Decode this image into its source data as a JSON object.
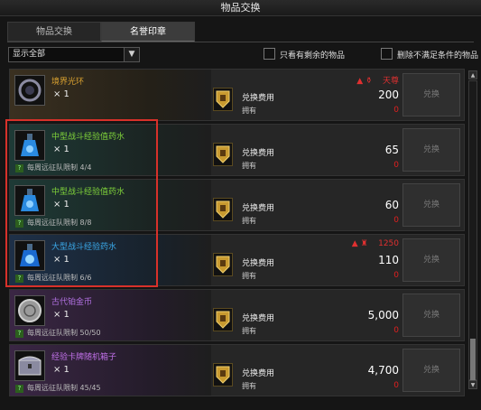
{
  "window": {
    "title": "物品交换"
  },
  "tabs": [
    {
      "label": "物品交换"
    },
    {
      "label": "名誉印章"
    }
  ],
  "filter": {
    "select_value": "显示全部",
    "only_remaining": "只看有剩余的物品",
    "hide_unmet": "删除不满足条件的物品"
  },
  "labels": {
    "cost": "兑换费用",
    "own": "拥有",
    "exchange_button": "兑换"
  },
  "items": [
    {
      "name": "境界光环",
      "qty": "× 1",
      "limit": "",
      "cost": "200",
      "own": "0",
      "rank_text": "天尊",
      "name_color": "#d8a030"
    },
    {
      "name": "中型战斗经验值药水",
      "qty": "× 1",
      "limit": "每周远征队限制 4/4",
      "cost": "65",
      "own": "0",
      "rank_text": "",
      "name_color": "#7fd23a"
    },
    {
      "name": "中型战斗经验值药水",
      "qty": "× 1",
      "limit": "每周远征队限制 8/8",
      "cost": "60",
      "own": "0",
      "rank_text": "",
      "name_color": "#7fd23a"
    },
    {
      "name": "大型战斗经验药水",
      "qty": "× 1",
      "limit": "每周远征队限制 6/6",
      "cost": "110",
      "own": "0",
      "rank_text": "1250",
      "name_color": "#3aa8e8"
    },
    {
      "name": "古代铂金币",
      "qty": "× 1",
      "limit": "每周远征队限制 50/50",
      "cost": "5,000",
      "own": "0",
      "rank_text": "",
      "name_color": "#b070e0"
    },
    {
      "name": "经验卡牌随机箱子",
      "qty": "× 1",
      "limit": "每周远征队限制 45/45",
      "cost": "4,700",
      "own": "0",
      "rank_text": "",
      "name_color": "#c070e8"
    }
  ]
}
